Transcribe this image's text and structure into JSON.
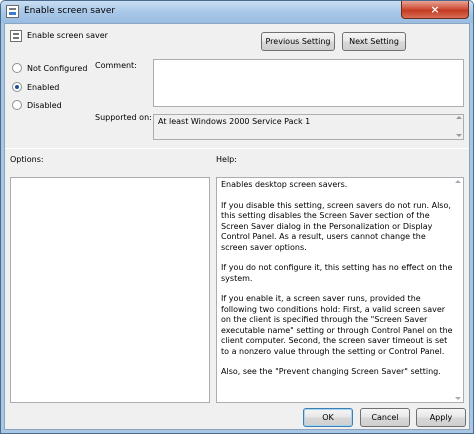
{
  "window": {
    "title": "Enable screen saver",
    "close_label": "×"
  },
  "header": {
    "setting_name": "Enable screen saver",
    "previous_label": "Previous Setting",
    "next_label": "Next Setting"
  },
  "state": {
    "options": [
      {
        "label": "Not Configured",
        "checked": false
      },
      {
        "label": "Enabled",
        "checked": true
      },
      {
        "label": "Disabled",
        "checked": false
      }
    ]
  },
  "comment": {
    "label": "Comment:",
    "value": ""
  },
  "supported": {
    "label": "Supported on:",
    "value": "At least Windows 2000 Service Pack 1"
  },
  "options_panel": {
    "label": "Options:"
  },
  "help_panel": {
    "label": "Help:",
    "paragraphs": [
      "Enables desktop screen savers.",
      "If you disable this setting, screen savers do not run. Also, this setting disables the Screen Saver section of the Screen Saver dialog in the Personalization or Display Control Panel. As a result, users cannot change the screen saver options.",
      "If you do not configure it, this setting has no effect on the system.",
      "If you enable it, a screen saver runs, provided the following two conditions hold: First, a valid screen saver on the client is specified through the \"Screen Saver executable name\" setting or through Control Panel on the client computer. Second, the screen saver timeout is set to a nonzero value through the setting or Control Panel.",
      "Also, see the \"Prevent changing Screen Saver\" setting."
    ]
  },
  "footer": {
    "ok_label": "OK",
    "cancel_label": "Cancel",
    "apply_label": "Apply"
  }
}
